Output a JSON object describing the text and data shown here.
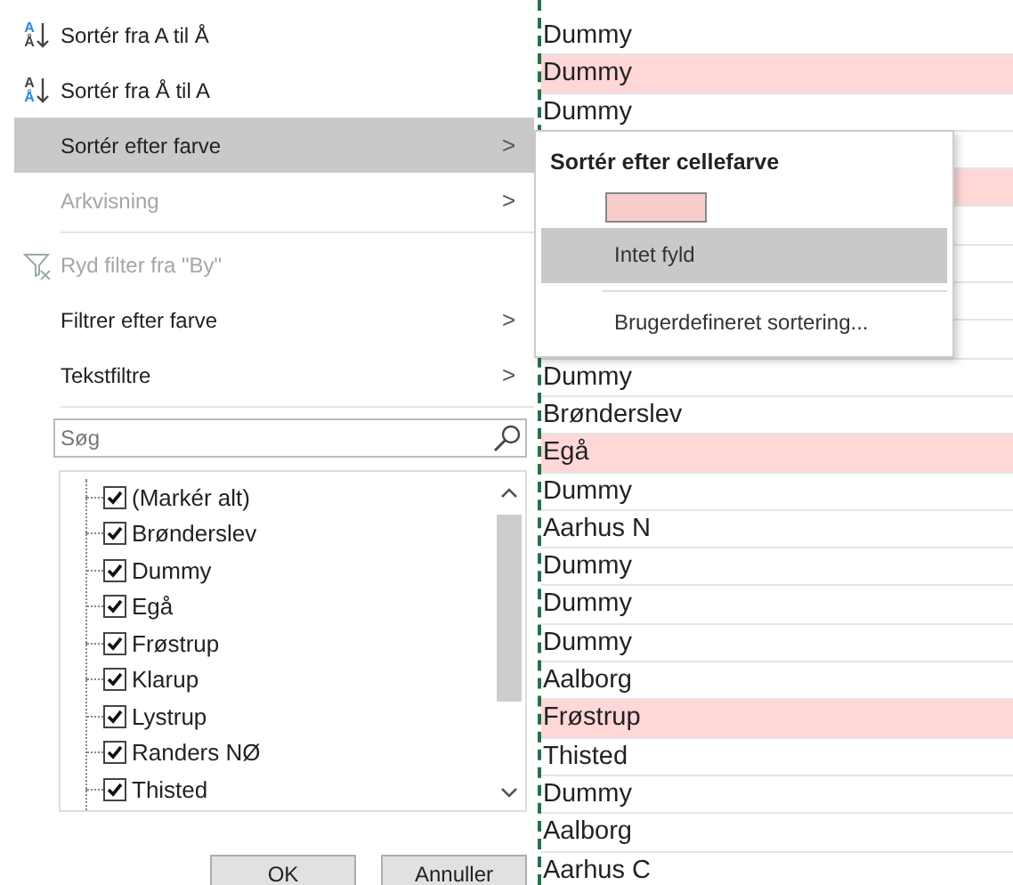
{
  "menu": {
    "items": [
      {
        "kind": "sort",
        "icon_letters": [
          "A",
          "Å"
        ],
        "label": "Sortér fra A til Å",
        "highlighted": false,
        "disabled": false,
        "submenu": false
      },
      {
        "kind": "sort",
        "icon_letters": [
          "A",
          "Å"
        ],
        "label": "Sortér fra Å til A",
        "highlighted": false,
        "disabled": false,
        "submenu": false
      },
      {
        "kind": "item",
        "label": "Sortér efter farve",
        "highlighted": true,
        "disabled": false,
        "submenu": true
      },
      {
        "kind": "item",
        "label": "Arkvisning",
        "highlighted": false,
        "disabled": true,
        "submenu": true
      },
      {
        "kind": "separator"
      },
      {
        "kind": "clear-filter",
        "label": "Ryd filter fra \"By\"",
        "highlighted": false,
        "disabled": true,
        "submenu": false
      },
      {
        "kind": "item",
        "label": "Filtrer efter farve",
        "highlighted": false,
        "disabled": false,
        "submenu": true
      },
      {
        "kind": "item",
        "label": "Tekstfiltre",
        "highlighted": false,
        "disabled": false,
        "submenu": true
      },
      {
        "kind": "separator"
      }
    ],
    "submenu_arrow": ">",
    "search": {
      "placeholder": "Søg"
    },
    "checklist": [
      {
        "label": "(Markér alt)",
        "checked": true
      },
      {
        "label": "Brønderslev",
        "checked": true
      },
      {
        "label": "Dummy",
        "checked": true
      },
      {
        "label": "Egå",
        "checked": true
      },
      {
        "label": "Frøstrup",
        "checked": true
      },
      {
        "label": "Klarup",
        "checked": true
      },
      {
        "label": "Lystrup",
        "checked": true
      },
      {
        "label": "Randers NØ",
        "checked": true
      },
      {
        "label": "Thisted",
        "checked": true
      }
    ],
    "buttons": [
      "OK",
      "Annuller"
    ]
  },
  "submenu": {
    "title": "Sortér efter cellefarve",
    "items": [
      {
        "kind": "swatch",
        "color": "#f8cdcd"
      },
      {
        "kind": "item",
        "label": "Intet fyld",
        "highlighted": true
      },
      {
        "kind": "separator"
      },
      {
        "kind": "item",
        "label": "Brugerdefineret sortering...",
        "highlighted": false
      }
    ]
  },
  "sheet": {
    "rows": [
      {
        "text": "Dummy",
        "highlighted": false
      },
      {
        "text": "Dummy",
        "highlighted": true
      },
      {
        "text": "Dummy",
        "highlighted": false
      },
      {
        "highlighted": false
      },
      {
        "highlighted": true
      },
      {
        "highlighted": false
      },
      {
        "highlighted": false
      },
      {
        "highlighted": false
      },
      {
        "highlighted": false
      },
      {
        "text": "Dummy",
        "highlighted": false
      },
      {
        "text": "Brønderslev",
        "highlighted": false
      },
      {
        "text": "Egå",
        "highlighted": true
      },
      {
        "text": "Dummy",
        "highlighted": false
      },
      {
        "text": "Aarhus N",
        "highlighted": false
      },
      {
        "text": "Dummy",
        "highlighted": false
      },
      {
        "text": "Dummy",
        "highlighted": false
      },
      {
        "text": "Dummy",
        "highlighted": false
      },
      {
        "text": "Aalborg",
        "highlighted": false
      },
      {
        "text": "Frøstrup",
        "highlighted": true
      },
      {
        "text": "Thisted",
        "highlighted": false
      },
      {
        "text": "Dummy",
        "highlighted": false
      },
      {
        "text": "Aalborg",
        "highlighted": false
      },
      {
        "text": "Aarhus C",
        "highlighted": false
      }
    ]
  }
}
